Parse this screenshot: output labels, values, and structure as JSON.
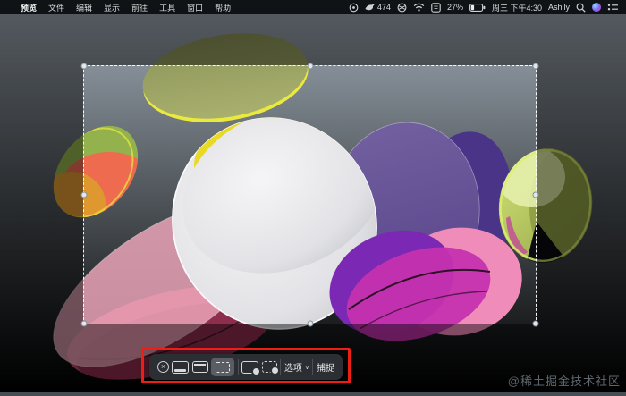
{
  "menu_bar": {
    "apple": "",
    "menus": [
      "预览",
      "文件",
      "编辑",
      "显示",
      "前往",
      "工具",
      "窗口",
      "帮助"
    ],
    "status": {
      "bird_count": "474",
      "battery_percent": "27%",
      "datetime": "周三 下午4:30",
      "username": "Ashily"
    }
  },
  "screenshot_toolbar": {
    "options_label": "选项",
    "options_chevron": "∨",
    "capture_label": "捕捉"
  },
  "watermark": "@稀土掘金技术社区",
  "colors": {
    "annotation_red": "#ed1f14",
    "menu_bar_bg": "#101316",
    "toolbar_bg": "#2b2e33",
    "toolbar_selected_bg": "#5a5e64",
    "dim_overlay": "rgba(0,0,0,0.46)",
    "wallpaper_base": "#97a2ac"
  }
}
